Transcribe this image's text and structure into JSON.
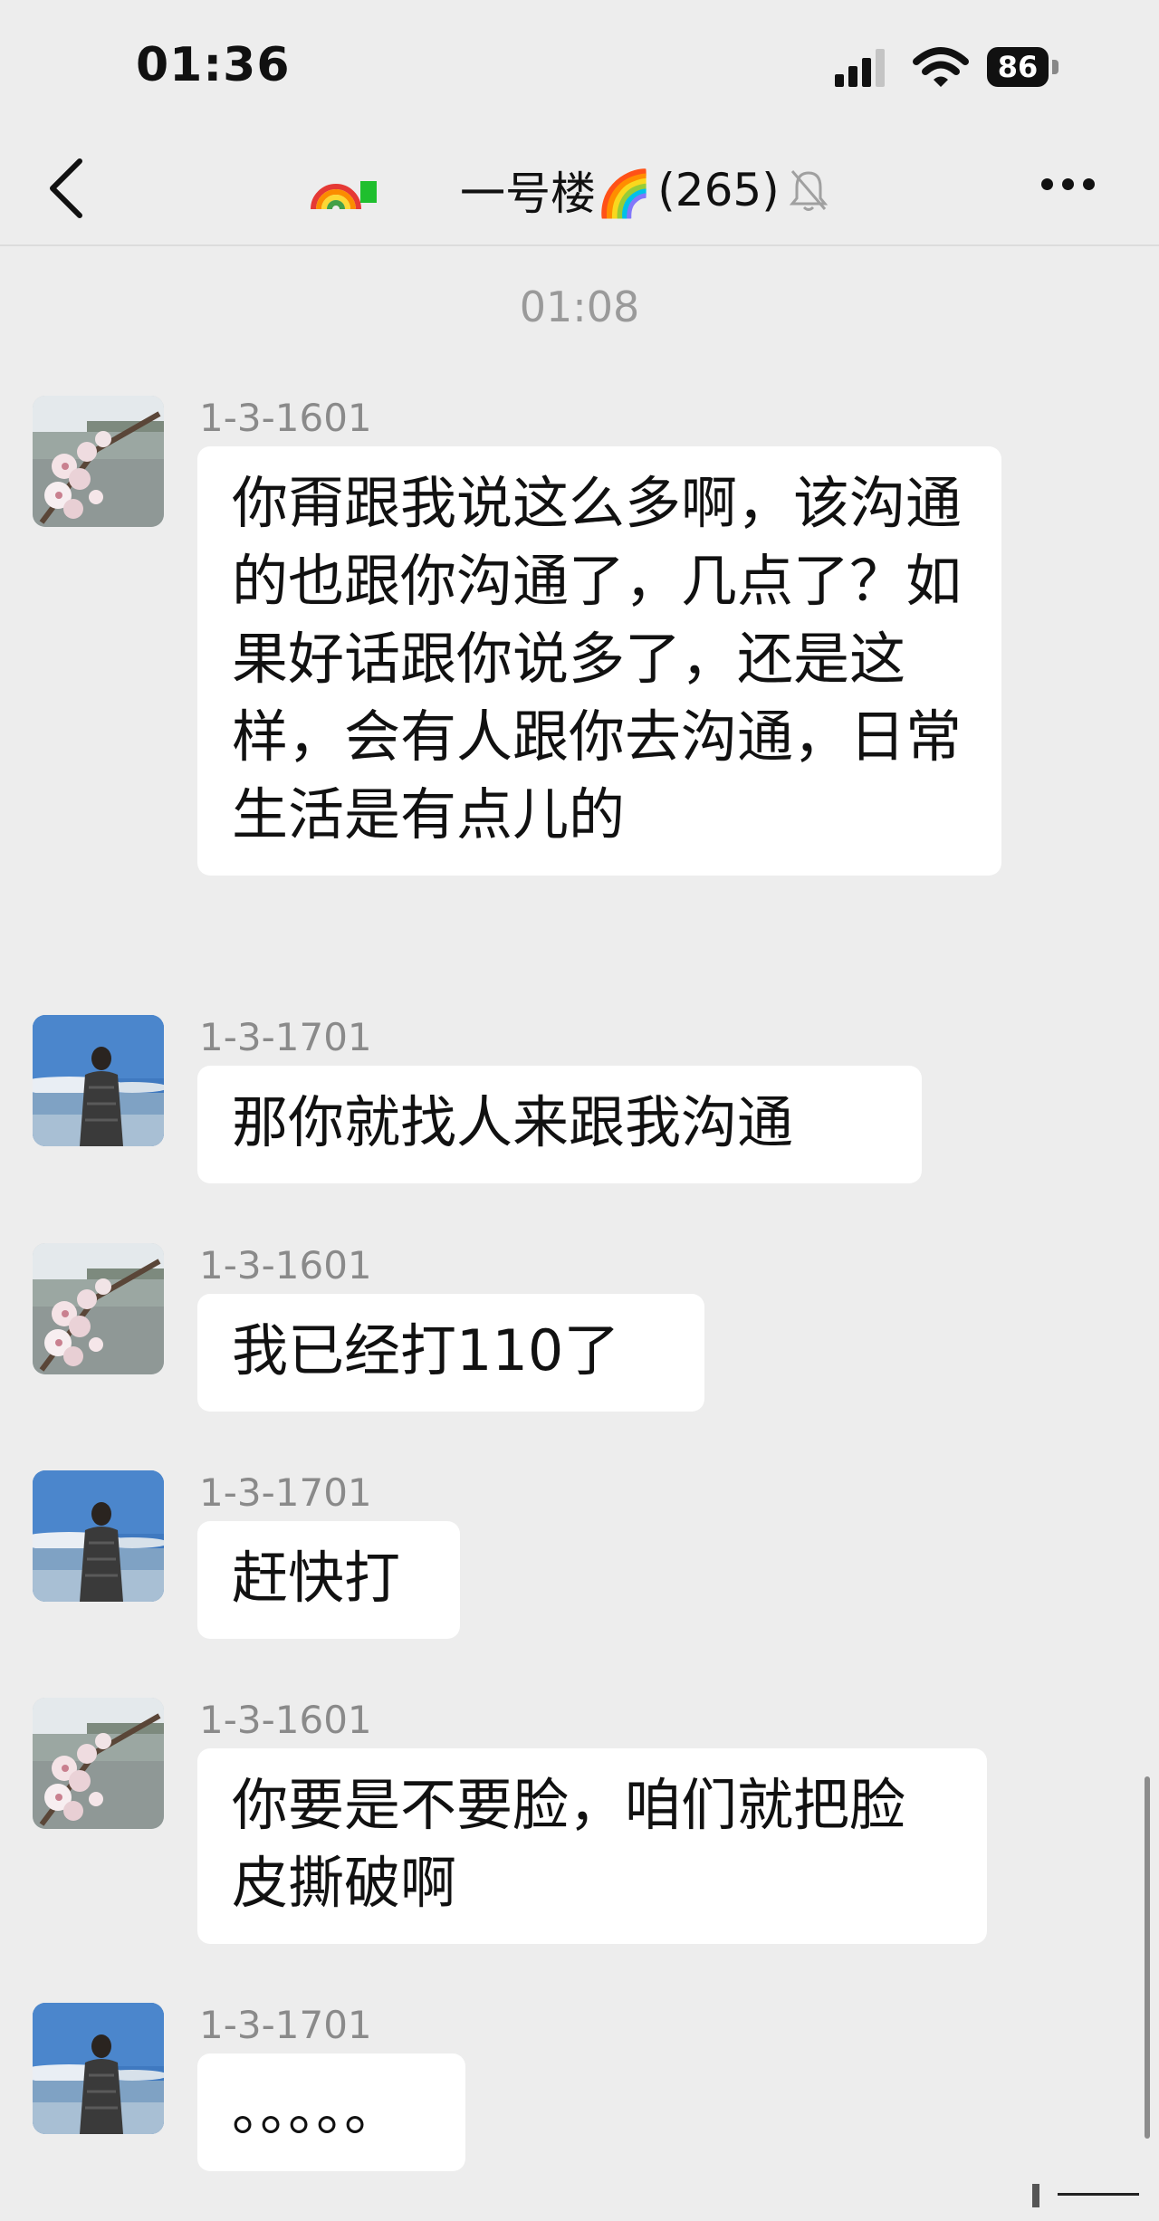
{
  "status_bar": {
    "time": "01:36",
    "battery": "86"
  },
  "nav": {
    "title": "一号楼🌈",
    "member_count": "(265)"
  },
  "chat": {
    "timestamp": "01:08",
    "messages": [
      {
        "sender": "1-3-1601",
        "avatar": "cherry-blossom-avatar",
        "text": " 你甭跟我说这么多啊，该沟通的也跟你沟通了，几点了？如果好话跟你说多了，还是这样，会有人跟你去沟通，日常生活是有点儿的"
      },
      {
        "sender": "1-3-1701",
        "avatar": "man-by-lake-avatar",
        "text": "那你就找人来跟我沟通"
      },
      {
        "sender": "1-3-1601",
        "avatar": "cherry-blossom-avatar",
        "text": "我已经打110了"
      },
      {
        "sender": "1-3-1701",
        "avatar": "man-by-lake-avatar",
        "text": "赶快打"
      },
      {
        "sender": "1-3-1601",
        "avatar": "cherry-blossom-avatar",
        "text": "你要是不要脸，咱们就把脸皮撕破啊"
      },
      {
        "sender": "1-3-1701",
        "avatar": "man-by-lake-avatar",
        "text": "。。。。。"
      }
    ]
  },
  "colors": {
    "background": "#ededed",
    "bubble": "#ffffff",
    "sender_text": "#8a8a8a"
  }
}
